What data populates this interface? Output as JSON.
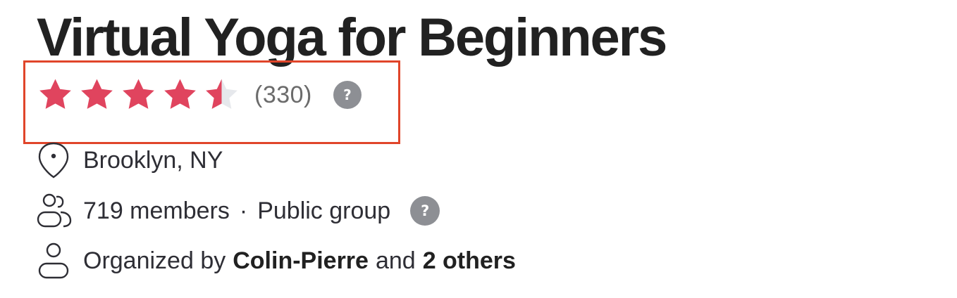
{
  "group": {
    "title": "Virtual Yoga for Beginners"
  },
  "rating": {
    "stars": 4.5,
    "max_stars": 5,
    "count_text": "(330)",
    "help_label": "?",
    "star_color": "#e0445e",
    "empty_star_color": "#e6e8ec"
  },
  "location": {
    "text": "Brooklyn, NY",
    "icon": "map-pin-icon"
  },
  "membership": {
    "members_text": "719 members",
    "separator": "·",
    "privacy_text": "Public group",
    "help_label": "?",
    "icon": "members-icon"
  },
  "organizer": {
    "prefix": "Organized by",
    "name": "Colin-Pierre",
    "connector": "and",
    "others": "2 others",
    "icon": "person-icon"
  },
  "highlight_color": "#e0452a"
}
